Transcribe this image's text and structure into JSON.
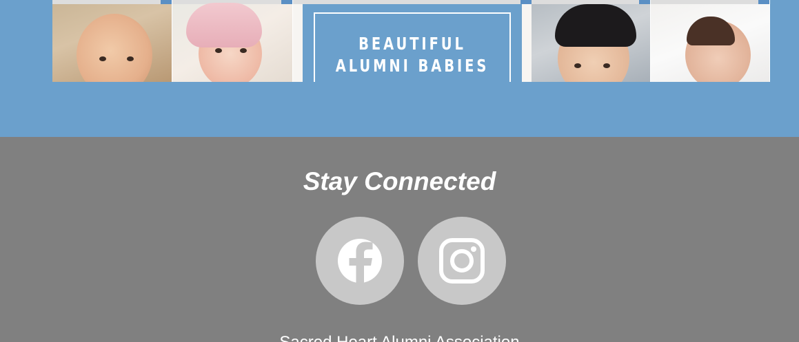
{
  "banner": {
    "poster_line1": "BEAUTIFUL",
    "poster_line2": "ALUMNI BABIES",
    "background_color": "#6ba0cc"
  },
  "footer": {
    "title": "Stay Connected",
    "social": [
      {
        "network": "Facebook",
        "icon": "facebook-icon"
      },
      {
        "network": "Instagram",
        "icon": "instagram-icon"
      }
    ],
    "organization": "Sacred Heart Alumni Association",
    "background_color": "#808080",
    "icon_circle_color": "#c8c8c8"
  }
}
